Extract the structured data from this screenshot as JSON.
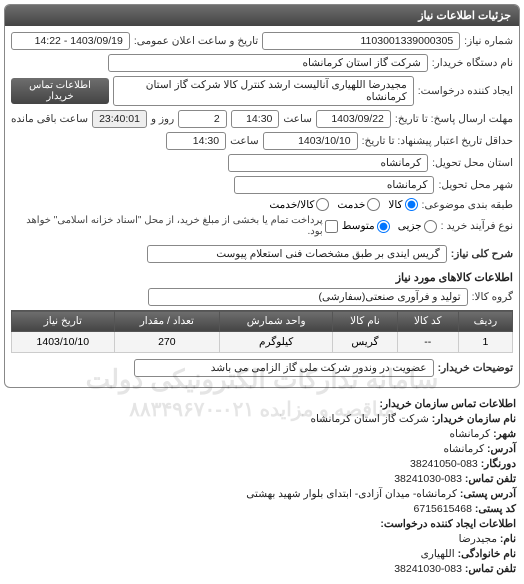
{
  "panel_title": "جزئیات اطلاعات نیاز",
  "fields": {
    "need_no_label": "شماره نیاز:",
    "need_no": "1103001339000305",
    "announce_label": "تاریخ و ساعت اعلان عمومی:",
    "announce": "1403/09/19 - 14:22",
    "buyer_org_label": "نام دستگاه خریدار:",
    "buyer_org": "شرکت گاز استان کرمانشاه",
    "creator_label": "ایجاد کننده درخواست:",
    "creator": "مجیدرضا اللهیاری آنالیست ارشد کنترل کالا شرکت گاز استان کرمانشاه",
    "contact_btn": "اطلاعات تماس خریدار",
    "reply_deadline_label": "مهلت ارسال پاسخ: تا تاریخ:",
    "reply_date": "1403/09/22",
    "reply_time_label": "ساعت",
    "reply_time": "14:30",
    "days_label": "روز و",
    "days": "2",
    "remain_label": "ساعت باقی مانده",
    "remain_time": "23:40:01",
    "validity_label": "حداقل تاریخ اعتبار پیشنهاد: تا تاریخ:",
    "validity_date": "1403/10/10",
    "validity_time": "14:30",
    "delivery_state_label": "استان محل تحویل:",
    "delivery_state": "کرمانشاه",
    "delivery_city_label": "شهر محل تحویل:",
    "delivery_city": "کرمانشاه",
    "class_label": "طبقه بندی موضوعی:",
    "radio_kala": "کالا",
    "radio_khadmat": "خدمت",
    "radio_kalakhadmat": "کالا/خدمت",
    "purchase_type_label": "نوع فرآیند خرید :",
    "radio_medium": "متوسط",
    "radio_partial": "جزیی",
    "purchase_note": "پرداخت تمام یا بخشی از مبلغ خرید، از محل \"اسناد خزانه اسلامی\" خواهد بود.",
    "need_title_label": "شرح کلی نیاز:",
    "need_title": "گریس ایندی بر طبق مشخصات فنی استعلام پیوست",
    "goods_section": "اطلاعات کالاهای مورد نیاز",
    "goods_group_label": "گروه کالا:",
    "goods_group": "تولید و فرآوری صنعتی(سفارشی)",
    "buyer_note_label": "توضیحات خریدار:",
    "buyer_note": "عضویت در وندور شرکت ملی گاز الزامی می باشد"
  },
  "table": {
    "headers": [
      "ردیف",
      "کد کالا",
      "نام کالا",
      "واحد شمارش",
      "تعداد / مقدار",
      "تاریخ نیاز"
    ],
    "rows": [
      {
        "idx": "1",
        "code": "--",
        "name": "گریس",
        "unit": "کیلوگرم",
        "qty": "270",
        "date": "1403/10/10"
      }
    ]
  },
  "contact": {
    "section": "اطلاعات تماس سازمان خریدار:",
    "org_label": "نام سازمان خریدار:",
    "org": "شرکت گاز استان کرمانشاه",
    "city_label": "شهر:",
    "city": "کرمانشاه",
    "address_label": "آدرس:",
    "address": "کرمانشاه",
    "fax_label": "دورنگار:",
    "fax": "083-38241050",
    "phone_label": "تلفن تماس:",
    "phone": "083-38241030",
    "postal_label": "آدرس پستی:",
    "postal": "کرمانشاه- میدان آزادی- ابتدای بلوار شهید بهشتی",
    "zip_label": "کد پستی:",
    "zip": "6715615468",
    "req_section": "اطلاعات ایجاد کننده درخواست:",
    "first_label": "نام:",
    "first": "مجیدرضا",
    "last_label": "نام خانوادگی:",
    "last": "اللهیاری",
    "cphone_label": "تلفن تماس:",
    "cphone": "083-38241030"
  },
  "watermark": {
    "line1": "سامانه تدارکات الکترونیکی دولت",
    "line2": "مناقصه و مزایده ۰۲۱-۸۸۳۴۹۶۷۰"
  }
}
